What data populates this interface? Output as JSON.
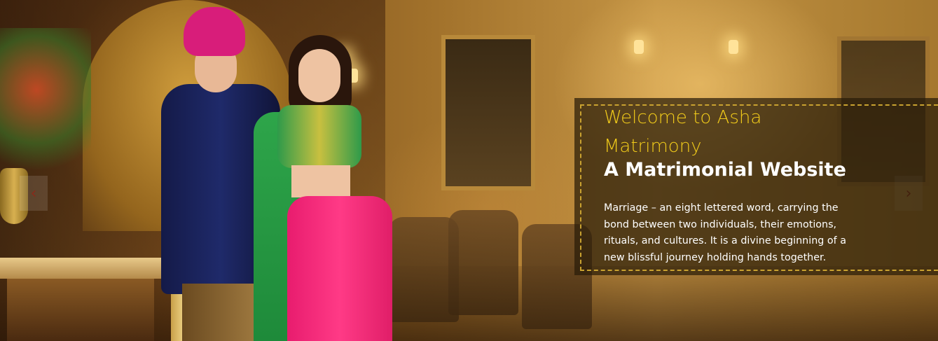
{
  "slider": {
    "prev_icon": "‹",
    "next_icon": "›",
    "arrow_color": "#8a2a1a"
  },
  "caption": {
    "welcome": "Welcome to Asha Matrimony",
    "headline": "A Matrimonial Website",
    "description": "Marriage – an eight lettered word, carrying the bond between two individuals, their emotions, rituals, and cultures. It is a divine beginning of a new blissful journey holding hands together.",
    "welcome_color": "#f2cc1a",
    "border_color": "#c9a230"
  }
}
